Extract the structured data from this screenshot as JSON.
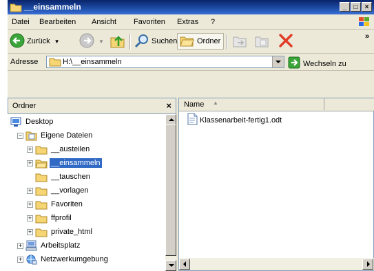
{
  "window": {
    "title": "__einsammeln"
  },
  "menu": [
    "Datei",
    "Bearbeiten",
    "Ansicht",
    "Favoriten",
    "Extras",
    "?"
  ],
  "toolbar": {
    "back_label": "Zurück",
    "search_label": "Suchen",
    "folders_label": "Ordner"
  },
  "address": {
    "label": "Adresse",
    "value": "H:\\__einsammeln",
    "go_label": "Wechseln zu"
  },
  "folder_pane": {
    "title": "Ordner",
    "close": "×",
    "items": [
      {
        "label": "Desktop",
        "level": 0,
        "icon": "desktop-icon",
        "expander": "none"
      },
      {
        "label": "Eigene Dateien",
        "level": 1,
        "icon": "my-documents-icon",
        "expander": "minus"
      },
      {
        "label": "__austeilen",
        "level": 2,
        "icon": "folder-icon",
        "expander": "plus"
      },
      {
        "label": "__einsammeln",
        "level": 2,
        "icon": "folder-open-icon",
        "expander": "plus",
        "selected": true
      },
      {
        "label": "__tauschen",
        "level": 2,
        "icon": "folder-icon",
        "expander": "none"
      },
      {
        "label": "__vorlagen",
        "level": 2,
        "icon": "folder-icon",
        "expander": "plus"
      },
      {
        "label": "Favoriten",
        "level": 2,
        "icon": "folder-icon",
        "expander": "plus"
      },
      {
        "label": "ffprofil",
        "level": 2,
        "icon": "folder-icon",
        "expander": "plus"
      },
      {
        "label": "private_html",
        "level": 2,
        "icon": "folder-icon",
        "expander": "plus"
      },
      {
        "label": "Arbeitsplatz",
        "level": 1,
        "icon": "my-computer-icon",
        "expander": "plus"
      },
      {
        "label": "Netzwerkumgebung",
        "level": 1,
        "icon": "network-icon",
        "expander": "plus"
      }
    ]
  },
  "file_pane": {
    "column_name": "Name",
    "files": [
      {
        "name": "Klassenarbeit-fertig1.odt",
        "icon": "document-icon"
      }
    ]
  },
  "colors": {
    "title_bar": "#0a246a",
    "selection": "#316ac5",
    "chrome": "#ece9d8"
  }
}
